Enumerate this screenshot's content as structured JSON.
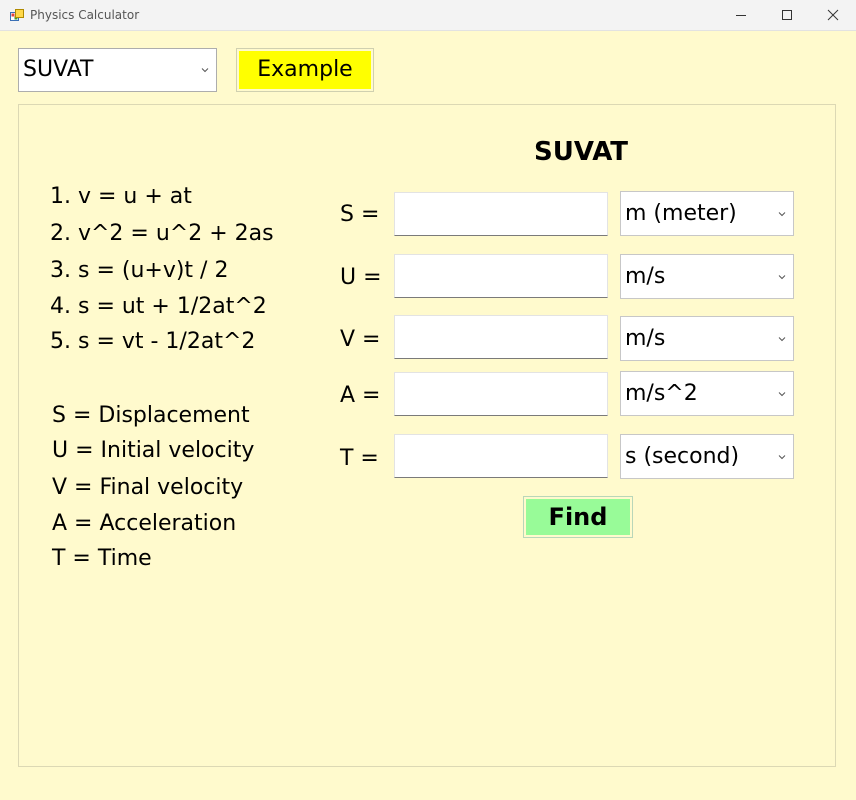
{
  "window": {
    "title": "Physics Calculator",
    "icons": {
      "app": "app-icon",
      "minimize": "minimize-icon",
      "maximize": "maximize-icon",
      "close": "close-icon"
    }
  },
  "toolbar": {
    "mode_select_value": "SUVAT",
    "example_label": "Example"
  },
  "equations": [
    "1. v = u + at",
    "2. v^2 = u^2 + 2as",
    "3. s = (u+v)t / 2",
    "4. s = ut + 1/2at^2",
    "5. s = vt - 1/2at^2"
  ],
  "legend": [
    "S = Displacement",
    "U = Initial velocity",
    "V = Final velocity",
    "A = Acceleration",
    "T = Time"
  ],
  "form": {
    "heading": "SUVAT",
    "fields": [
      {
        "label": "S =",
        "value": "",
        "unit": "m (meter)"
      },
      {
        "label": "U =",
        "value": "",
        "unit": "m/s"
      },
      {
        "label": "V =",
        "value": "",
        "unit": "m/s"
      },
      {
        "label": "A =",
        "value": "",
        "unit": "m/s^2"
      },
      {
        "label": "T =",
        "value": "",
        "unit": "s (second)"
      }
    ],
    "find_label": "Find"
  },
  "colors": {
    "background": "#fffacd",
    "example_button": "#ffff00",
    "find_button": "#98fb98"
  }
}
